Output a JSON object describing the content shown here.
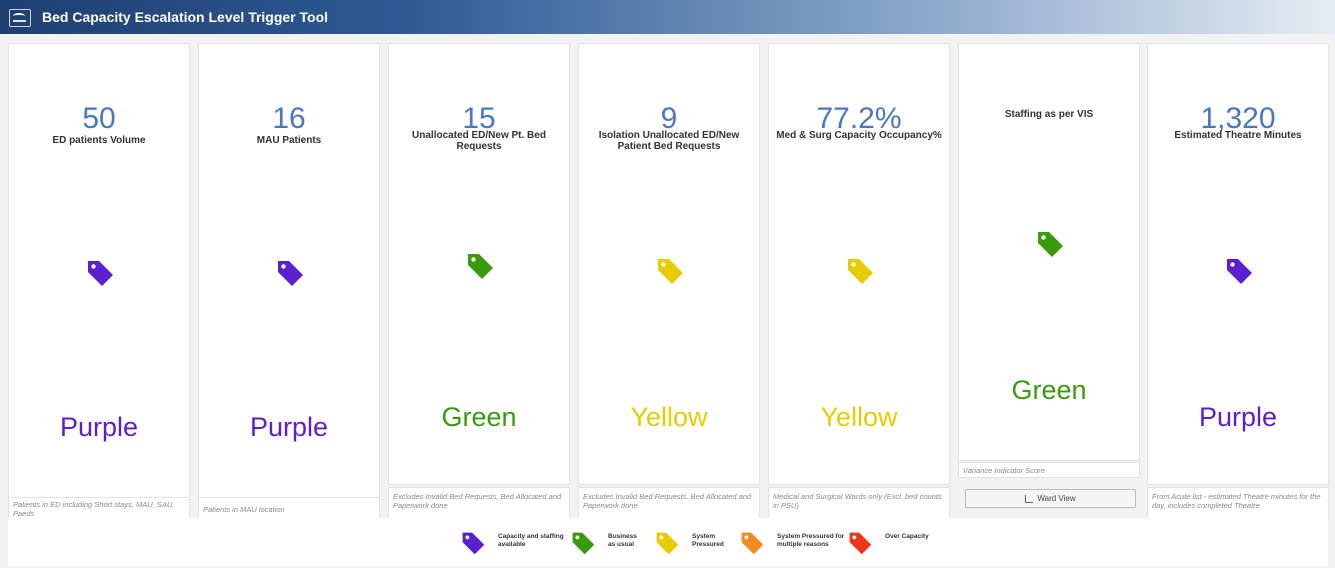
{
  "header": {
    "title": "Bed Capacity Escalation Level Trigger Tool"
  },
  "cards": [
    {
      "value": "50",
      "label": "ED patients Volume",
      "status": "Purple",
      "color": "#5b1fcf",
      "footer": "Patients in ED including Short stays, MAU, SAU, Paeds"
    },
    {
      "value": "16",
      "label": "MAU Patients",
      "status": "Purple",
      "color": "#5b1fcf",
      "footer": "Patients in MAU location"
    },
    {
      "value": "15",
      "label": "Unallocated ED/New Pt. Bed Requests",
      "status": "Green",
      "color": "#3a9a0e",
      "footer": "Excludes Invalid Bed Requests, Bed Allocated and Paperwork done"
    },
    {
      "value": "9",
      "label": "Isolation Unallocated ED/New Patient Bed Requests",
      "status": "Yellow",
      "color": "#e6cc00",
      "footer": "Excludes Invalid Bed Requests, Bed Allocated and Paperwork done"
    },
    {
      "value": "77.2%",
      "label": "Med & Surg Capacity Occupancy%",
      "status": "Yellow",
      "color": "#e6cc00",
      "footer": "Medical and Surgical Wards only (Excl. bed counts in PSU)"
    },
    {
      "value": "",
      "label": "Staffing as per VIS",
      "status": "Green",
      "color": "#3a9a0e",
      "footer": "Variance Indicator Score",
      "button": "Ward View"
    },
    {
      "value": "1,320",
      "label": "Estimated Theatre Minutes",
      "status": "Purple",
      "color": "#5b1fcf",
      "footer": "From Acute list - estimated Theatre minutes for the day, includes completed Theatre"
    }
  ],
  "legend": [
    {
      "label": "Capacity and staffing available",
      "color": "#5b1fcf"
    },
    {
      "label": "Business as usual",
      "color": "#3a9a0e"
    },
    {
      "label": "System Pressured",
      "color": "#e6cc00"
    },
    {
      "label": "System Pressured for multiple reasons",
      "color": "#f28c1e"
    },
    {
      "label": "Over Capacity",
      "color": "#f0341a"
    }
  ],
  "icons": {
    "tag": "tag-icon",
    "ward_view": "bar-chart-icon",
    "logo": "logo-icon"
  }
}
